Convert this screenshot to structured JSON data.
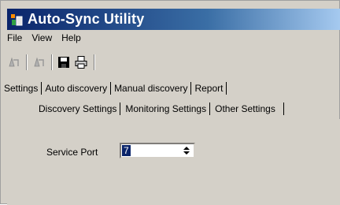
{
  "window": {
    "title": "Auto-Sync Utility",
    "title_icon": "app-icon"
  },
  "menu": {
    "items": [
      "File",
      "View",
      "Help"
    ]
  },
  "toolbar": {
    "buttons": [
      {
        "icon": "sync-disabled-icon"
      },
      {
        "icon": "sync-disabled-icon-2"
      },
      {
        "icon": "save-icon"
      },
      {
        "icon": "print-icon"
      }
    ]
  },
  "tabs": {
    "primary": [
      "Settings",
      "Auto discovery",
      "Manual discovery",
      "Report"
    ],
    "secondary": [
      "Discovery Settings",
      "Monitoring Settings",
      "Other Settings"
    ]
  },
  "settings": {
    "service_port_label": "Service Port",
    "service_port_value": "7"
  },
  "colors": {
    "titlebar_start": "#0a246a",
    "titlebar_end": "#a6caf0",
    "selection": "#0a246a",
    "window_bg": "#d4d0c8"
  }
}
